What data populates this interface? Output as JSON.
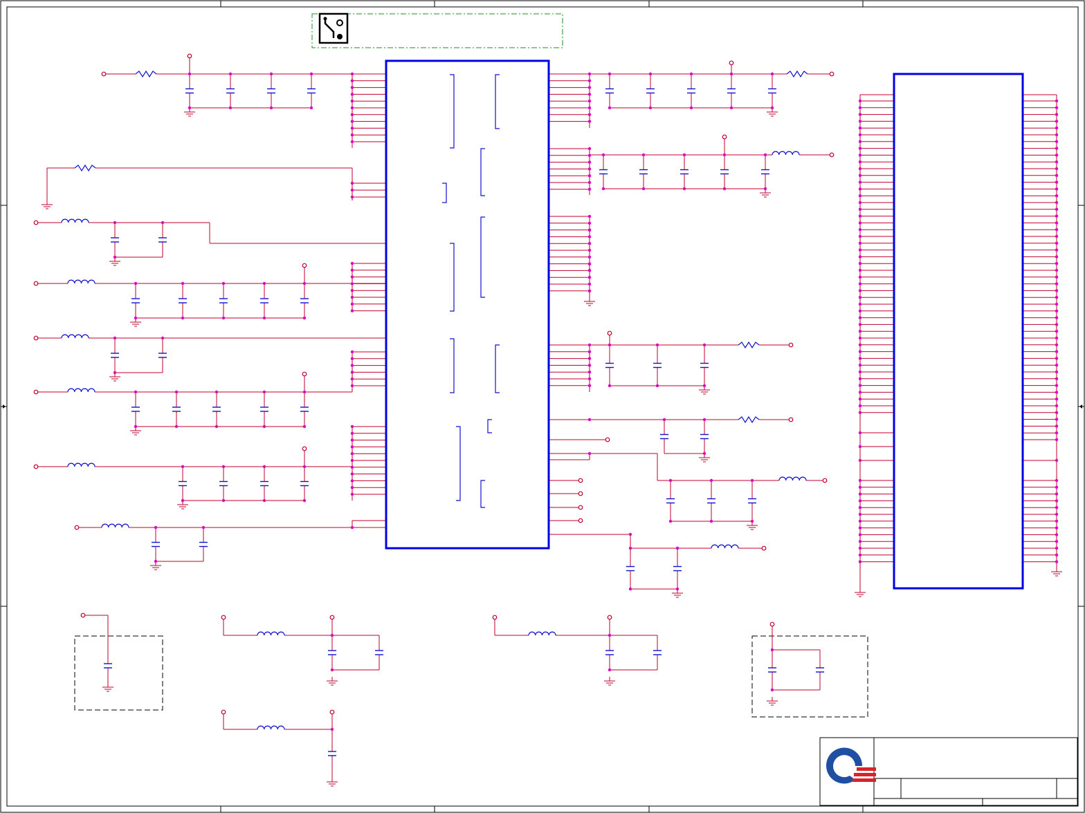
{
  "colors": {
    "wire": "#c0002a",
    "component": "#1010d0",
    "ic_outline": "#0000e0",
    "junction": "#e000c0",
    "ground": "#c0002a",
    "frame": "#000000",
    "group_box": "#1f8f1f",
    "logo_blue": "#1f4fa3",
    "logo_red": "#d8232a"
  },
  "icons": {
    "pcb_badge": "pcb-trace-icon",
    "company_logo": "company-logo-icon"
  },
  "title_block": {
    "title": "",
    "sheet": ""
  }
}
